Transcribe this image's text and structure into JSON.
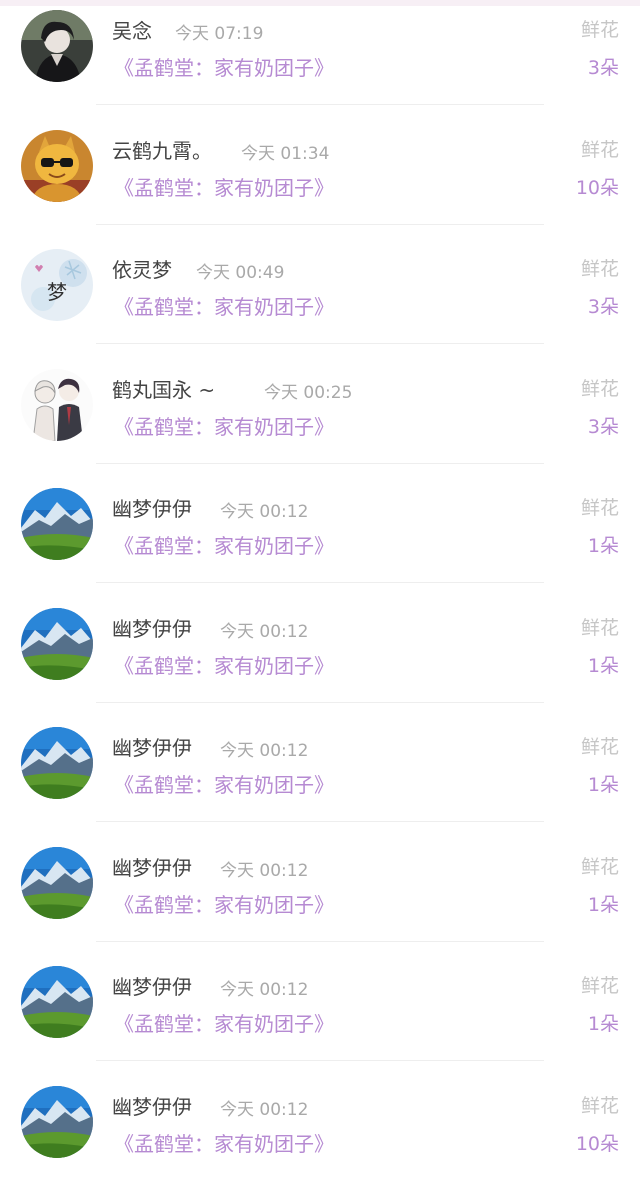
{
  "gifts": [
    {
      "user": "吴念",
      "time": "今天 07:19",
      "book": "《孟鹤堂：家有奶团子》",
      "gift_type": "鲜花",
      "quantity": "3朵",
      "avatar": "dark-portrait-avatar"
    },
    {
      "user": "云鹤九霄。",
      "time": "今天 01:34",
      "book": "《孟鹤堂：家有奶团子》",
      "gift_type": "鲜花",
      "quantity": "10朵",
      "avatar": "golden-cat-avatar"
    },
    {
      "user": "依灵梦",
      "time": "今天 00:49",
      "book": "《孟鹤堂：家有奶团子》",
      "gift_type": "鲜花",
      "quantity": "3朵",
      "avatar": "dream-text-avatar",
      "avatar_text": "梦"
    },
    {
      "user": "鹤丸国永 ~",
      "time": "今天 00:25",
      "book": "《孟鹤堂：家有奶团子》",
      "gift_type": "鲜花",
      "quantity": "3朵",
      "avatar": "anime-couple-avatar"
    },
    {
      "user": "幽梦伊伊",
      "time": "今天 00:12",
      "book": "《孟鹤堂：家有奶团子》",
      "gift_type": "鲜花",
      "quantity": "1朵",
      "avatar": "mountain-landscape-avatar"
    },
    {
      "user": "幽梦伊伊",
      "time": "今天 00:12",
      "book": "《孟鹤堂：家有奶团子》",
      "gift_type": "鲜花",
      "quantity": "1朵",
      "avatar": "mountain-landscape-avatar"
    },
    {
      "user": "幽梦伊伊",
      "time": "今天 00:12",
      "book": "《孟鹤堂：家有奶团子》",
      "gift_type": "鲜花",
      "quantity": "1朵",
      "avatar": "mountain-landscape-avatar"
    },
    {
      "user": "幽梦伊伊",
      "time": "今天 00:12",
      "book": "《孟鹤堂：家有奶团子》",
      "gift_type": "鲜花",
      "quantity": "1朵",
      "avatar": "mountain-landscape-avatar"
    },
    {
      "user": "幽梦伊伊",
      "time": "今天 00:12",
      "book": "《孟鹤堂：家有奶团子》",
      "gift_type": "鲜花",
      "quantity": "1朵",
      "avatar": "mountain-landscape-avatar"
    },
    {
      "user": "幽梦伊伊",
      "time": "今天 00:12",
      "book": "《孟鹤堂：家有奶团子》",
      "gift_type": "鲜花",
      "quantity": "10朵",
      "avatar": "mountain-landscape-avatar"
    }
  ],
  "colors": {
    "accent_purple": "#b68ad2",
    "name_text": "#444444",
    "meta_text": "#a9a9a9",
    "gift_label": "#c6c6c6"
  }
}
